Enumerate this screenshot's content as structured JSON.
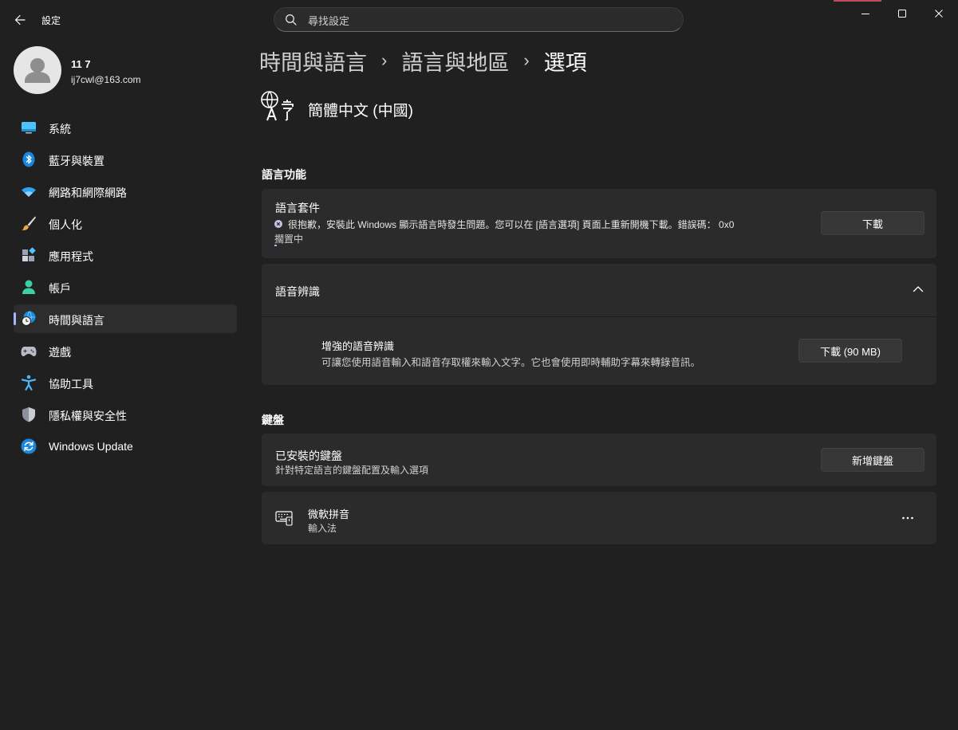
{
  "app": {
    "title": "設定",
    "search_placeholder": "尋找設定"
  },
  "user": {
    "name": "11 7",
    "email": "ij7cwl@163.com"
  },
  "sidebar": {
    "items": [
      {
        "label": "系統",
        "icon": "system-icon"
      },
      {
        "label": "藍牙與裝置",
        "icon": "bluetooth-icon"
      },
      {
        "label": "網路和網際網路",
        "icon": "wifi-icon"
      },
      {
        "label": "個人化",
        "icon": "brush-icon"
      },
      {
        "label": "應用程式",
        "icon": "apps-icon"
      },
      {
        "label": "帳戶",
        "icon": "account-icon"
      },
      {
        "label": "時間與語言",
        "icon": "time-language-icon",
        "active": true
      },
      {
        "label": "遊戲",
        "icon": "gamepad-icon"
      },
      {
        "label": "協助工具",
        "icon": "accessibility-icon"
      },
      {
        "label": "隱私權與安全性",
        "icon": "shield-icon"
      },
      {
        "label": "Windows Update",
        "icon": "windows-update-icon"
      }
    ]
  },
  "breadcrumb": [
    "時間與語言",
    "語言與地區",
    "選項"
  ],
  "language": {
    "name": "簡體中文 (中國)"
  },
  "language_features": {
    "section_title": "語言功能",
    "pack": {
      "title": "語言套件",
      "error": "很抱歉，安裝此 Windows 顯示語言時發生問題。您可以在 [語言選項] 頁面上重新開機下載。錯誤碼： 0x0",
      "status": "擱置中",
      "button": "下載"
    },
    "speech": {
      "title": "語音辨識",
      "enhanced_title": "增強的語音辨識",
      "enhanced_desc": "可讓您使用語音輸入和語音存取權來輸入文字。它也會使用即時輔助字幕來轉錄音訊。",
      "button": "下載 (90 MB)"
    }
  },
  "keyboard": {
    "section_title": "鍵盤",
    "installed_title": "已安裝的鍵盤",
    "installed_desc": "針對特定語言的鍵盤配置及輸入選項",
    "add_button": "新增鍵盤",
    "items": [
      {
        "name": "微軟拼音",
        "type": "輸入法"
      }
    ]
  },
  "colors": {
    "accent": "#a9b4ff",
    "background": "#202020",
    "card": "#2b2b2b"
  }
}
